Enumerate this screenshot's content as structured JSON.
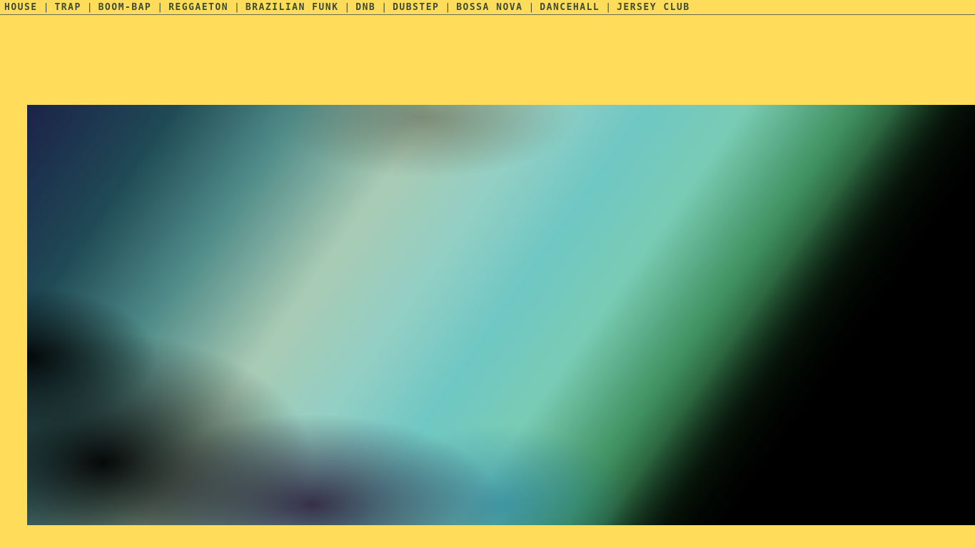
{
  "nav": {
    "items": [
      {
        "label": "HOUSE"
      },
      {
        "label": "TRAP"
      },
      {
        "label": "BOOM-BAP"
      },
      {
        "label": "REGGAETON"
      },
      {
        "label": "BRAZILIAN FUNK"
      },
      {
        "label": "DNB"
      },
      {
        "label": "DUBSTEP"
      },
      {
        "label": "BOSSA NOVA"
      },
      {
        "label": "DANCEHALL"
      },
      {
        "label": "JERSEY CLUB"
      }
    ],
    "separator": "|"
  },
  "colors": {
    "background": "#ffdd5a",
    "nav_text": "#3d4a35"
  }
}
